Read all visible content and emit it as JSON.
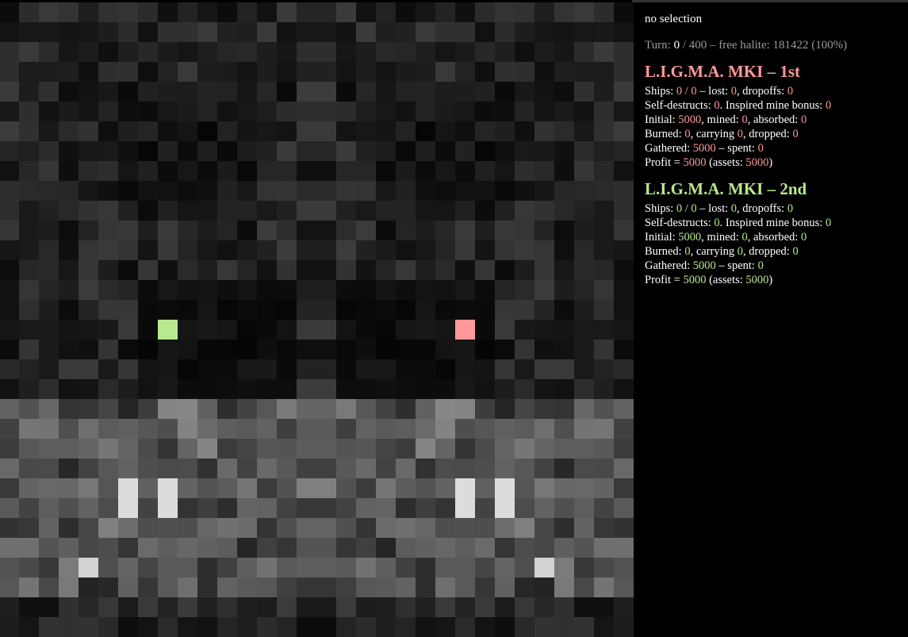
{
  "status": {
    "selection": "no selection"
  },
  "turn": {
    "label": "Turn: ",
    "current": "0",
    "max_text": " / 400",
    "halite_text": " – free halite: 181422 (100%)"
  },
  "players": [
    {
      "name": "L.I.G.M.A. MKI – 1st",
      "color": "#ff9999",
      "ships": "0",
      "ships_total": "0",
      "lost": "0",
      "dropoffs": "0",
      "self_destructs": "0",
      "inspired_bonus": "0",
      "initial": "5000",
      "mined": "0",
      "absorbed": "0",
      "burned": "0",
      "carrying": "0",
      "dropped": "0",
      "gathered": "5000",
      "spent": "0",
      "profit": "5000",
      "assets": "5000"
    },
    {
      "name": "L.I.G.M.A. MKI – 2nd",
      "color": "#b8e890",
      "ships": "0",
      "ships_total": "0",
      "lost": "0",
      "dropoffs": "0",
      "self_destructs": "0",
      "inspired_bonus": "0",
      "initial": "5000",
      "mined": "0",
      "absorbed": "0",
      "burned": "0",
      "carrying": "0",
      "dropped": "0",
      "gathered": "5000",
      "spent": "0",
      "profit": "5000",
      "assets": "5000"
    }
  ],
  "labels": {
    "ships": "Ships: ",
    "lost": " – lost: ",
    "dropoffs": ", dropoffs: ",
    "self_destructs": "Self-destructs: ",
    "inspired": ". Inspired mine bonus: ",
    "initial": "Initial: ",
    "mined": ", mined: ",
    "absorbed": ", absorbed: ",
    "burned": "Burned: ",
    "carrying": ", carrying ",
    "dropped": ", dropped: ",
    "gathered": "Gathered: ",
    "spent": " – spent: ",
    "profit": "Profit = ",
    "assets": " (assets: ",
    "close": ")",
    "slash": " / "
  },
  "map": {
    "size": 32,
    "shipyards": [
      {
        "row": 16,
        "col": 8,
        "color": "#b8e890",
        "owner": "L.I.G.M.A. MKI – 2nd"
      },
      {
        "row": 16,
        "col": 23,
        "color": "#ff9999",
        "owner": "L.I.G.M.A. MKI – 1st"
      }
    ]
  }
}
